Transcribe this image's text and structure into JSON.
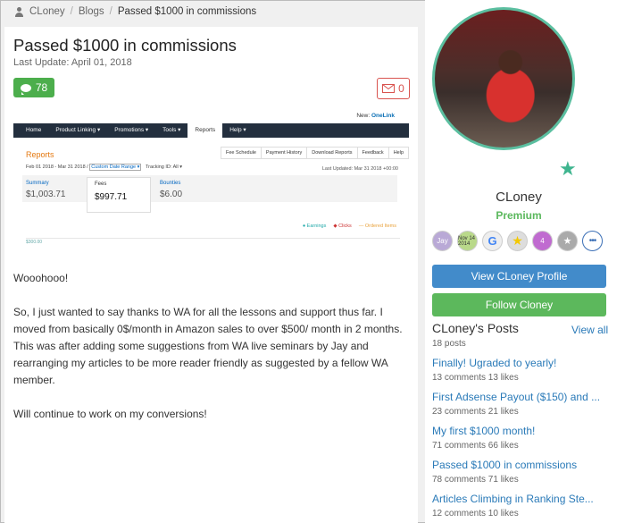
{
  "breadcrumb": {
    "user": "CLoney",
    "blogs": "Blogs",
    "current": "Passed $1000 in commissions"
  },
  "post": {
    "title": "Passed $1000 in commissions",
    "last_update": "Last Update: April 01, 2018",
    "comment_count": "78",
    "mail_count": "0",
    "paragraphs": [
      "Wooohooo!",
      "So, I just wanted to say thanks to WA for all the lessons and support thus far. I moved from basically 0$/month in Amazon sales to over $500/ month in 2 months. This was after adding some suggestions from WA live seminars by Jay and rearranging my articles to be more reader friendly as suggested by a fellow WA member.",
      "Will continue to work on my conversions!"
    ]
  },
  "screenshot": {
    "new_label": "New:",
    "new_link": "OneLink",
    "nav": [
      "Home",
      "Product Linking ▾",
      "Promotions ▾",
      "Tools ▾",
      "Reports",
      "Help ▾"
    ],
    "reports_title": "Reports",
    "tabs": [
      "Fee Schedule",
      "Payment History",
      "Download Reports",
      "Feedback",
      "Help"
    ],
    "range": "Feb 01 2018 - Mar 31 2018 /",
    "range_custom": "Custom Date Range ▾",
    "tracking": "Tracking ID: All ▾",
    "updated": "Last Updated: Mar 31 2018 +00:00",
    "summary_label": "Summary",
    "summary_value": "$1,003.71",
    "fees_label": "Fees",
    "fees_value": "$997.71",
    "bounties_label": "Bounties",
    "bounties_value": "$6.00",
    "legend": [
      "● Earnings",
      "◆ Clicks",
      "— Ordered Items"
    ],
    "axis_label": "$300.00"
  },
  "sidebar": {
    "name": "CLoney",
    "membership": "Premium",
    "badges": [
      "Jay",
      "Nov 14 2014",
      "G",
      "★",
      "4",
      "★",
      "•••"
    ],
    "view_profile": "View CLoney Profile",
    "follow": "Follow Cloney",
    "posts_title": "CLoney's Posts",
    "view_all": "View all",
    "posts_count": "18 posts",
    "posts": [
      {
        "title": "Finally! Ugraded to yearly!",
        "meta": "13 comments   13 likes"
      },
      {
        "title": "First Adsense Payout ($150) and ...",
        "meta": "23 comments   21 likes"
      },
      {
        "title": "My first $1000 month!",
        "meta": "71 comments   66 likes"
      },
      {
        "title": "Passed $1000 in commissions",
        "meta": "78 comments   71 likes"
      },
      {
        "title": "Articles Climbing in Ranking Ste...",
        "meta": "12 comments   10 likes"
      }
    ]
  }
}
